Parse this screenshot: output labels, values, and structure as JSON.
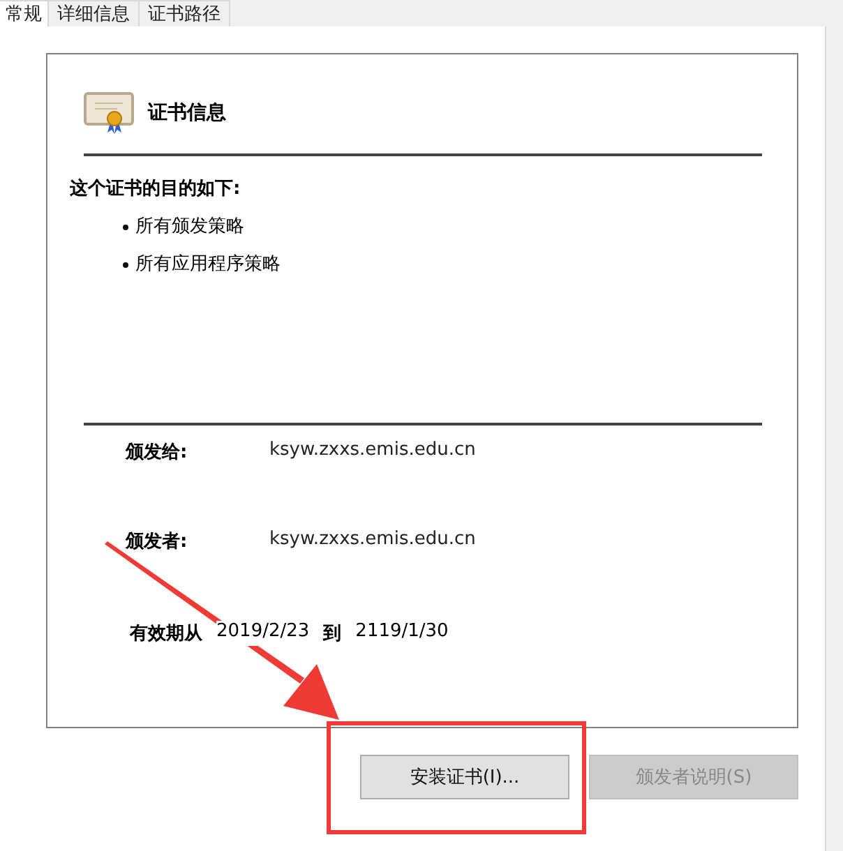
{
  "tabs": [
    {
      "label": "常规",
      "selected": true
    },
    {
      "label": "详细信息",
      "selected": false
    },
    {
      "label": "证书路径",
      "selected": false
    }
  ],
  "certificate": {
    "title": "证书信息",
    "purpose_title": "这个证书的目的如下:",
    "purposes": [
      "所有颁发策略",
      "所有应用程序策略"
    ],
    "fields": [
      {
        "label": "颁发给:",
        "value": "ksyw.zxxs.emis.edu.cn"
      },
      {
        "label": "颁发者:",
        "value": "ksyw.zxxs.emis.edu.cn"
      }
    ],
    "validity": {
      "label": "有效期从",
      "from": "2019/2/23",
      "to_label": "到",
      "to": "2119/1/30"
    }
  },
  "buttons": [
    {
      "label": "安装证书(I)...",
      "disabled": false
    },
    {
      "label": "颁发者说明(S)",
      "disabled": true
    }
  ]
}
